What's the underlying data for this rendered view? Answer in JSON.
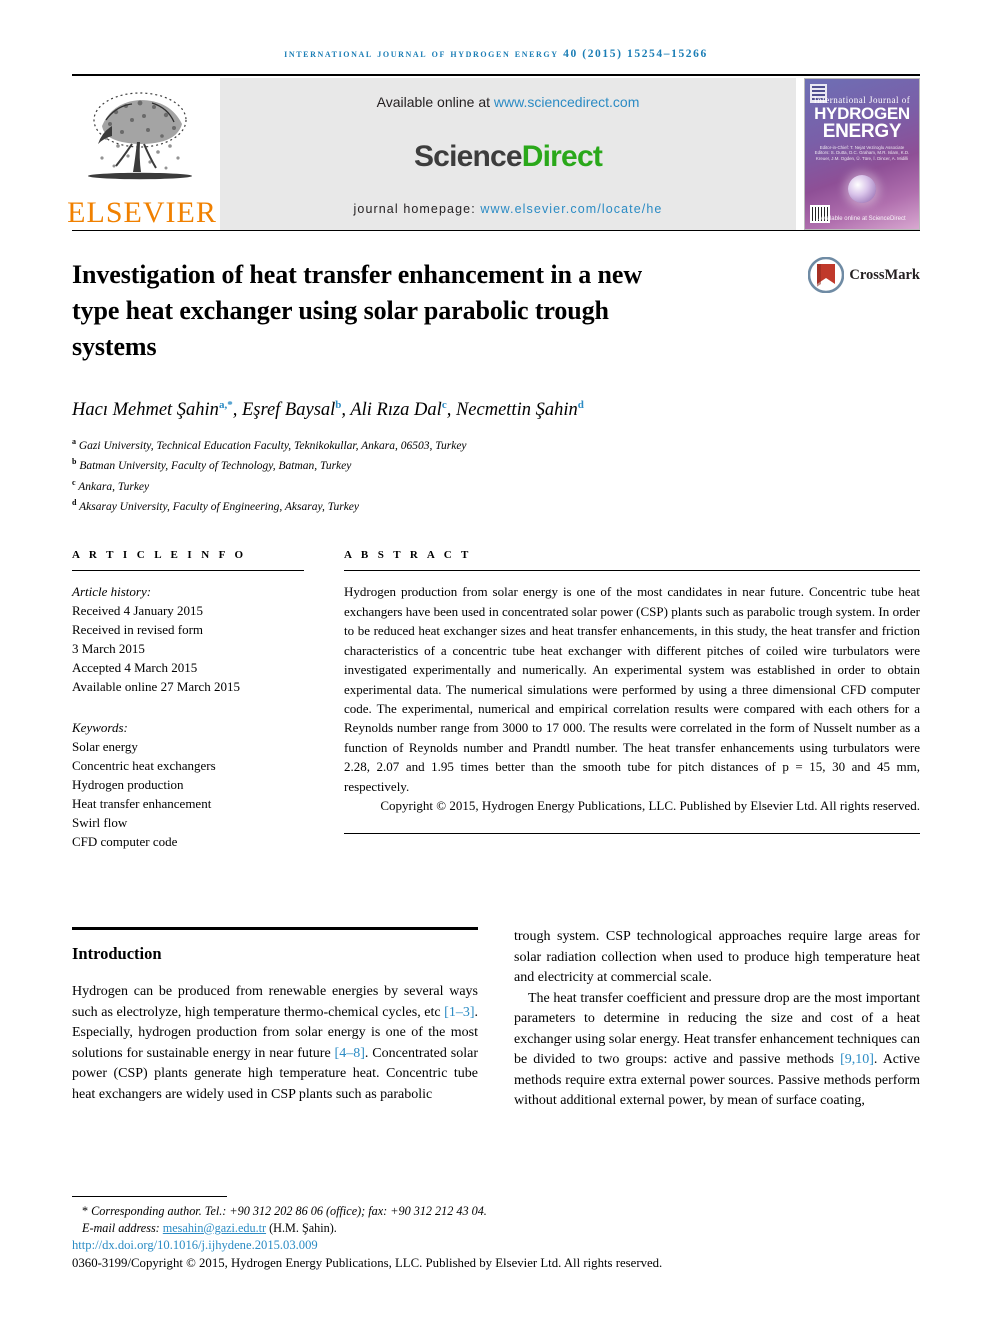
{
  "running_head": "International Journal of Hydrogen Energy 40 (2015) 15254–15266",
  "masthead": {
    "publisher_name": "ELSEVIER",
    "available_prefix": "Available online at ",
    "available_url": "www.sciencedirect.com",
    "sciencedirect_part1": "Science",
    "sciencedirect_part2": "Direct",
    "homepage_label": "journal homepage: ",
    "homepage_url": "www.elsevier.com/locate/he",
    "cover": {
      "line_small": "International Journal of",
      "line_big1": "HYDROGEN",
      "line_big2": "ENERGY",
      "editors": "Editor-in-Chief: T. Nejat Veziroglu    Associate Editors: S. Dutta, D.C. Graham, M.R. Islam, K.D. Kreuer, J.M. Ogden, Ü. Türe, İ. Dincer, A. Midilli",
      "footer": "Available online at ScienceDirect"
    }
  },
  "article": {
    "title": "Investigation of heat transfer enhancement in a new type heat exchanger using solar parabolic trough systems",
    "crossmark_label": "CrossMark",
    "authors": [
      {
        "name": "Hacı Mehmet Şahin",
        "marks": "a,*"
      },
      {
        "name": "Eşref Baysal",
        "marks": "b"
      },
      {
        "name": "Ali Rıza Dal",
        "marks": "c"
      },
      {
        "name": "Necmettin Şahin",
        "marks": "d"
      }
    ],
    "affiliations": [
      {
        "mark": "a",
        "text": "Gazi University, Technical Education Faculty, Teknikokullar, Ankara, 06503, Turkey"
      },
      {
        "mark": "b",
        "text": "Batman University, Faculty of Technology, Batman, Turkey"
      },
      {
        "mark": "c",
        "text": "Ankara, Turkey"
      },
      {
        "mark": "d",
        "text": "Aksaray University, Faculty of Engineering, Aksaray, Turkey"
      }
    ]
  },
  "article_info": {
    "heading": "A R T I C L E  I N F O",
    "history_label": "Article history:",
    "history": [
      "Received 4 January 2015",
      "Received in revised form",
      "3 March 2015",
      "Accepted 4 March 2015",
      "Available online 27 March 2015"
    ],
    "keywords_label": "Keywords:",
    "keywords": [
      "Solar energy",
      "Concentric heat exchangers",
      "Hydrogen production",
      "Heat transfer enhancement",
      "Swirl flow",
      "CFD computer code"
    ]
  },
  "abstract": {
    "heading": "A B S T R A C T",
    "body": "Hydrogen production from solar energy is one of the most candidates in near future. Concentric tube heat exchangers have been used in concentrated solar power (CSP) plants such as parabolic trough system. In order to be reduced heat exchanger sizes and heat transfer enhancements, in this study, the heat transfer and friction characteristics of a concentric tube heat exchanger with different pitches of coiled wire turbulators were investigated experimentally and numerically. An experimental system was established in order to obtain experimental data. The numerical simulations were performed by using a three dimensional CFD computer code. The experimental, numerical and empirical correlation results were compared with each others for a Reynolds number range from 3000 to 17 000. The results were correlated in the form of Nusselt number as a function of Reynolds number and Prandtl number. The heat transfer enhancements using turbulators were 2.28, 2.07 and 1.95 times better than the smooth tube for pitch distances of p = 15, 30 and 45 mm, respectively.",
    "copyright": "Copyright © 2015, Hydrogen Energy Publications, LLC. Published by Elsevier Ltd. All rights reserved."
  },
  "introduction": {
    "heading": "Introduction",
    "left_para1_a": "Hydrogen can be produced from renewable energies by several ways such as electrolyze, high temperature thermo-chemical cycles, etc ",
    "left_cite1": "[1–3]",
    "left_para1_b": ". Especially, hydrogen production from solar energy is one of the most solutions for sustainable energy in near future ",
    "left_cite2": "[4–8]",
    "left_para1_c": ". Concentrated solar power (CSP) plants generate high temperature heat. Concentric tube heat exchangers are widely used in CSP plants such as parabolic",
    "right_para1": "trough system. CSP technological approaches require large areas for solar radiation collection when used to produce high temperature heat and electricity at commercial scale.",
    "right_para2_a": "The heat transfer coefficient and pressure drop are the most important parameters to determine in reducing the size and cost of a heat exchanger using solar energy. Heat transfer enhancement techniques can be divided to two groups: active and passive methods ",
    "right_cite1": "[9,10]",
    "right_para2_b": ". Active methods require extra external power sources. Passive methods perform without additional external power, by mean of surface coating,"
  },
  "footnote": {
    "corresponding_marker": "*",
    "corresponding_text": " Corresponding author. Tel.: +90 312 202 86 06 (office); fax: +90 312 212 43 04.",
    "email_label": "E-mail address: ",
    "email": "mesahin@gazi.edu.tr",
    "email_suffix": " (H.M. Şahin).",
    "doi": "http://dx.doi.org/10.1016/j.ijhydene.2015.03.009",
    "issn_copyright": "0360-3199/Copyright © 2015, Hydrogen Energy Publications, LLC. Published by Elsevier Ltd. All rights reserved."
  },
  "colors": {
    "link_blue": "#2b8bc4",
    "elsevier_orange": "#f08000",
    "sciencedirect_green": "#2aa81a",
    "running_head_blue": "#1a7db5"
  }
}
